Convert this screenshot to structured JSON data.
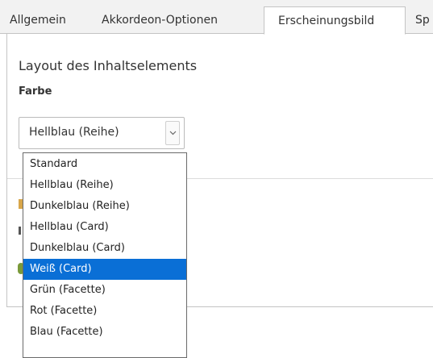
{
  "tabs": [
    {
      "label": "Allgemein"
    },
    {
      "label": "Akkordeon-Optionen"
    },
    {
      "label": "Erscheinungsbild"
    },
    {
      "label": "Sp"
    }
  ],
  "section": {
    "title": "Layout des Inhaltselements"
  },
  "field": {
    "label": "Farbe"
  },
  "select": {
    "value": "Hellblau (Reihe)"
  },
  "dropdown": {
    "options": [
      {
        "label": "Standard"
      },
      {
        "label": "Hellblau (Reihe)"
      },
      {
        "label": "Dunkelblau (Reihe)"
      },
      {
        "label": "Hellblau (Card)"
      },
      {
        "label": "Dunkelblau (Card)"
      },
      {
        "label": "Weiß (Card)"
      },
      {
        "label": "Grün (Facette)"
      },
      {
        "label": "Rot (Facette)"
      },
      {
        "label": "Blau (Facette)"
      }
    ],
    "highlighted": "Weiß (Card)"
  },
  "colors": {
    "highlight": "#0a6fd6",
    "active_tab_bg": "#ffffff",
    "tabbar_bg": "#f2f2f2"
  }
}
